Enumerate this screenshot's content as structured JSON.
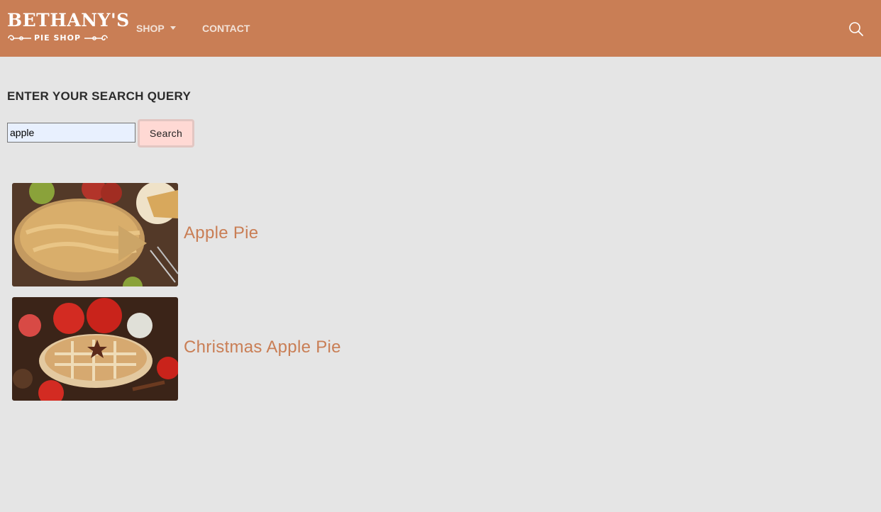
{
  "brand": {
    "name": "BETHANY'S",
    "tagline": "PIE SHOP",
    "color": "#c97e55"
  },
  "nav": {
    "shop_label": "SHOP",
    "contact_label": "CONTACT",
    "search_icon": "search-icon"
  },
  "search": {
    "heading": "ENTER YOUR SEARCH QUERY",
    "value": "apple",
    "placeholder": "",
    "button_label": "Search"
  },
  "results": [
    {
      "title": "Apple Pie",
      "image": "apple-pie-photo"
    },
    {
      "title": "Christmas Apple Pie",
      "image": "christmas-apple-pie-photo"
    }
  ]
}
